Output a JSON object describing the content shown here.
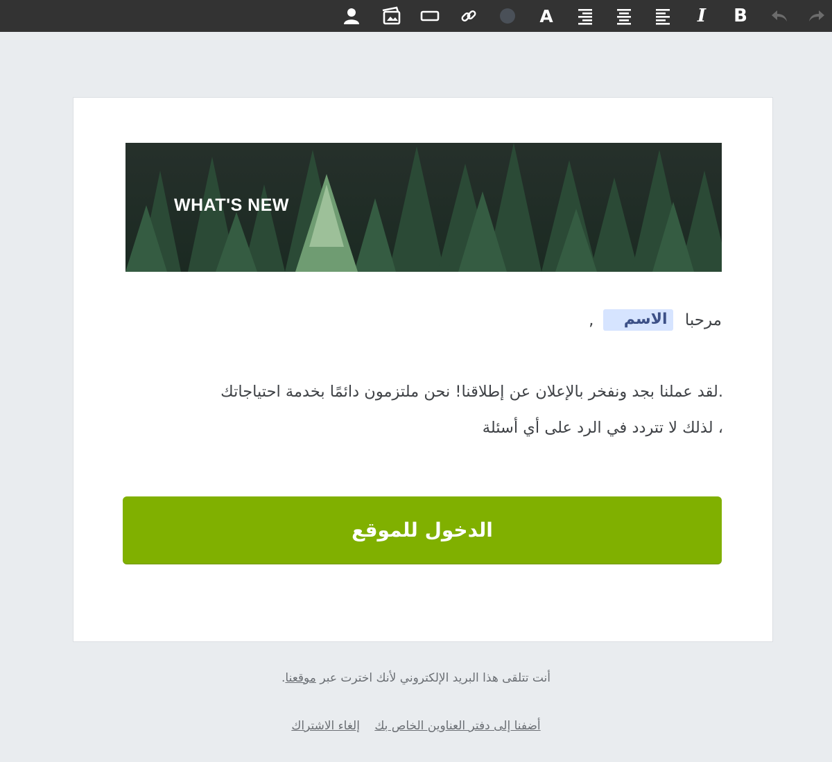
{
  "toolbar": {
    "items": [
      {
        "icon": "user-icon"
      },
      {
        "icon": "image-icon"
      },
      {
        "icon": "button-block-icon"
      },
      {
        "icon": "link-icon"
      },
      {
        "icon": "color-circle-icon",
        "color": "#4a5058"
      },
      {
        "icon": "font-a-icon",
        "label": "A"
      },
      {
        "icon": "align-right-icon"
      },
      {
        "icon": "align-center-icon"
      },
      {
        "icon": "align-left-icon"
      },
      {
        "icon": "italic-icon",
        "label": "I"
      },
      {
        "icon": "bold-icon",
        "label": "B"
      },
      {
        "icon": "undo-icon"
      },
      {
        "icon": "redo-icon"
      }
    ]
  },
  "email": {
    "banner": {
      "text": "WHAT'S NEW"
    },
    "greeting": {
      "hello": "مرحبا",
      "name_placeholder": "الاسم",
      "comma": ","
    },
    "body_lines": [
      ".لقد عملنا بجد ونفخر بالإعلان عن إطلاقنا! نحن ملتزمون دائمًا بخدمة احتياجاتك",
      "، لذلك لا تتردد في الرد على أي أسئلة"
    ],
    "cta_label": "الدخول للموقع"
  },
  "footer": {
    "note_prefix": "أنت تتلقى هذا البريد الإلكتروني لأنك اخترت عبر ",
    "note_link": "موقعنا",
    "note_suffix": ".",
    "link_addressbook": "أضفنا إلى دفتر العناوين الخاص بك",
    "link_unsubscribe": "إلغاء الاشتراك"
  },
  "colors": {
    "toolbar_bg": "#333333",
    "page_bg": "#e9ecef",
    "cta_bg": "#80b000",
    "name_tag_bg": "#d6e4ff"
  }
}
